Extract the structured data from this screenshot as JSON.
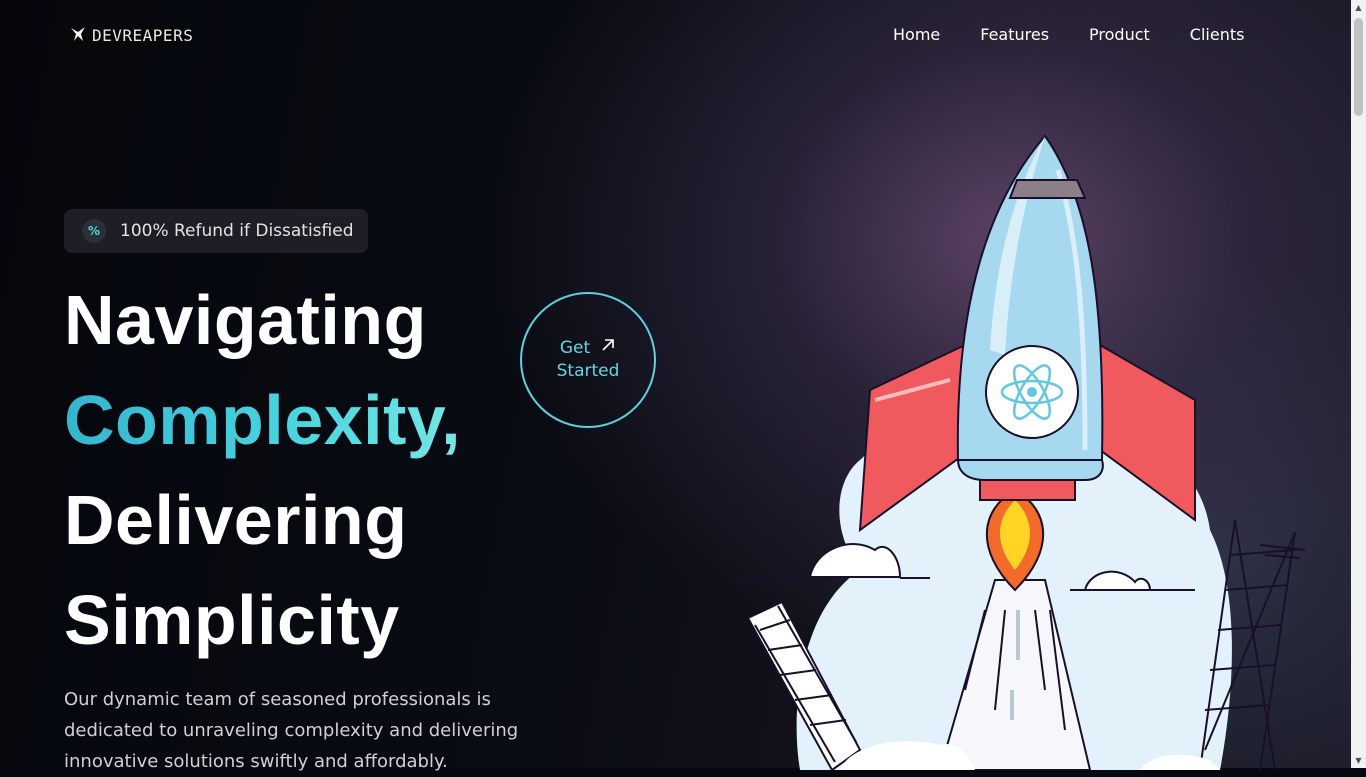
{
  "brand": {
    "logo_text": "DEVREAPERS"
  },
  "nav": {
    "items": [
      "Home",
      "Features",
      "Product",
      "Clients"
    ]
  },
  "hero": {
    "badge": {
      "icon": "percent-icon",
      "text": "100% Refund if Dissatisfied"
    },
    "headline": [
      "Navigating",
      "Complexity,",
      "Delivering",
      "Simplicity"
    ],
    "description": "Our dynamic team of seasoned professionals is dedicated to unraveling complexity and delivering innovative solutions swiftly and affordably.",
    "cta": {
      "line1": "Get",
      "line2": "Started",
      "icon": "arrow-up-right-icon"
    }
  },
  "colors": {
    "accent": "#4ad6e0",
    "background": "#06080f",
    "rocket_fin": "#f05a5f",
    "rocket_body": "#a6d8ef"
  }
}
